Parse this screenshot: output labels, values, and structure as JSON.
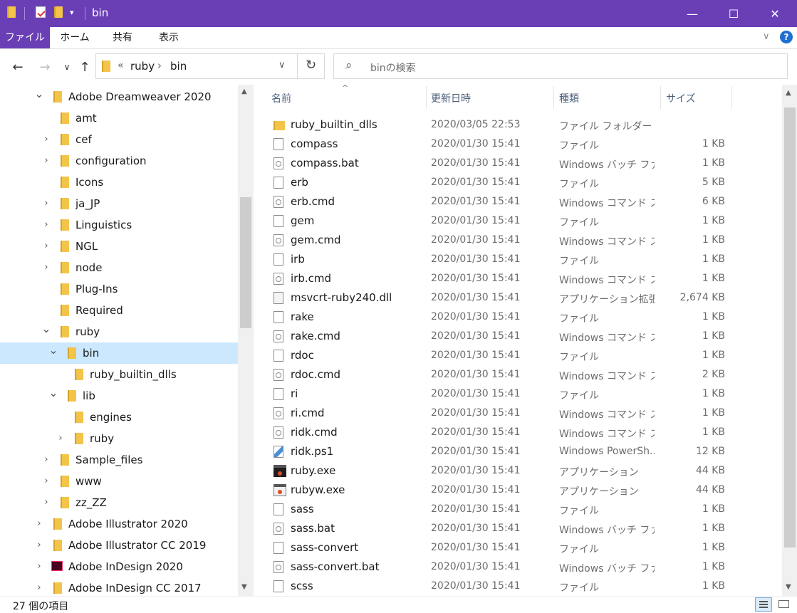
{
  "window": {
    "title": "bin",
    "colors": {
      "titlebar": "#6a3fb6",
      "selected_row": "#cce8ff",
      "folder": "#f2c44a"
    }
  },
  "quick_access": {
    "icons": [
      "folder-icon",
      "properties-icon",
      "new-folder-icon",
      "customize-dropdown-icon"
    ]
  },
  "window_controls": {
    "minimize": "—",
    "maximize": "☐",
    "close": "✕"
  },
  "ribbon": {
    "tabs": [
      {
        "label": "ファイル"
      },
      {
        "label": "ホーム"
      },
      {
        "label": "共有"
      },
      {
        "label": "表示"
      }
    ],
    "expand_glyph": "∨",
    "help_glyph": "?"
  },
  "nav": {
    "back": "←",
    "forward": "→",
    "recent": "∨",
    "up": "↑",
    "address": {
      "overflow": "«",
      "segments": [
        "ruby",
        "bin"
      ],
      "sep": "›",
      "dropdown": "∨",
      "refresh": "↻"
    },
    "search": {
      "placeholder": "binの検索",
      "icon": "⌕"
    }
  },
  "tree": [
    {
      "label": "Adobe Dreamweaver 2020",
      "state": "expanded",
      "level": 0
    },
    {
      "label": "amt",
      "state": "none",
      "level": 1
    },
    {
      "label": "cef",
      "state": "collapsed",
      "level": 1
    },
    {
      "label": "configuration",
      "state": "collapsed",
      "level": 1
    },
    {
      "label": "Icons",
      "state": "none",
      "level": 1
    },
    {
      "label": "ja_JP",
      "state": "collapsed",
      "level": 1
    },
    {
      "label": "Linguistics",
      "state": "collapsed",
      "level": 1
    },
    {
      "label": "NGL",
      "state": "collapsed",
      "level": 1
    },
    {
      "label": "node",
      "state": "collapsed",
      "level": 1
    },
    {
      "label": "Plug-Ins",
      "state": "none",
      "level": 1
    },
    {
      "label": "Required",
      "state": "none",
      "level": 1
    },
    {
      "label": "ruby",
      "state": "expanded",
      "level": 1
    },
    {
      "label": "bin",
      "state": "expanded",
      "level": 2,
      "selected": true
    },
    {
      "label": "ruby_builtin_dlls",
      "state": "none",
      "level": 3
    },
    {
      "label": "lib",
      "state": "expanded",
      "level": 2
    },
    {
      "label": "engines",
      "state": "none",
      "level": 3
    },
    {
      "label": "ruby",
      "state": "collapsed",
      "level": 3
    },
    {
      "label": "Sample_files",
      "state": "collapsed",
      "level": 1
    },
    {
      "label": "www",
      "state": "collapsed",
      "level": 1
    },
    {
      "label": "zz_ZZ",
      "state": "collapsed",
      "level": 1
    },
    {
      "label": "Adobe Illustrator 2020",
      "state": "collapsed",
      "level": 0
    },
    {
      "label": "Adobe Illustrator CC 2019",
      "state": "collapsed",
      "level": 0
    },
    {
      "label": "Adobe InDesign 2020",
      "state": "collapsed",
      "level": 0,
      "icon": "indesign-icon"
    },
    {
      "label": "Adobe InDesign CC 2017",
      "state": "collapsed",
      "level": 0
    }
  ],
  "columns": {
    "name": "名前",
    "date": "更新日時",
    "type": "種類",
    "size": "サイズ",
    "sort_glyph": "^"
  },
  "files": [
    {
      "name": "ruby_builtin_dlls",
      "date": "2020/03/05 22:53",
      "type": "ファイル フォルダー",
      "size": "",
      "icon": "folder"
    },
    {
      "name": "compass",
      "date": "2020/01/30 15:41",
      "type": "ファイル",
      "size": "1 KB",
      "icon": "file"
    },
    {
      "name": "compass.bat",
      "date": "2020/01/30 15:41",
      "type": "Windows バッチ ファ...",
      "size": "1 KB",
      "icon": "gear"
    },
    {
      "name": "erb",
      "date": "2020/01/30 15:41",
      "type": "ファイル",
      "size": "5 KB",
      "icon": "file"
    },
    {
      "name": "erb.cmd",
      "date": "2020/01/30 15:41",
      "type": "Windows コマンド ス...",
      "size": "6 KB",
      "icon": "gear"
    },
    {
      "name": "gem",
      "date": "2020/01/30 15:41",
      "type": "ファイル",
      "size": "1 KB",
      "icon": "file"
    },
    {
      "name": "gem.cmd",
      "date": "2020/01/30 15:41",
      "type": "Windows コマンド ス...",
      "size": "1 KB",
      "icon": "gear"
    },
    {
      "name": "irb",
      "date": "2020/01/30 15:41",
      "type": "ファイル",
      "size": "1 KB",
      "icon": "file"
    },
    {
      "name": "irb.cmd",
      "date": "2020/01/30 15:41",
      "type": "Windows コマンド ス...",
      "size": "1 KB",
      "icon": "gear"
    },
    {
      "name": "msvcrt-ruby240.dll",
      "date": "2020/01/30 15:41",
      "type": "アプリケーション拡張",
      "size": "2,674 KB",
      "icon": "dll"
    },
    {
      "name": "rake",
      "date": "2020/01/30 15:41",
      "type": "ファイル",
      "size": "1 KB",
      "icon": "file"
    },
    {
      "name": "rake.cmd",
      "date": "2020/01/30 15:41",
      "type": "Windows コマンド ス...",
      "size": "1 KB",
      "icon": "gear"
    },
    {
      "name": "rdoc",
      "date": "2020/01/30 15:41",
      "type": "ファイル",
      "size": "1 KB",
      "icon": "file"
    },
    {
      "name": "rdoc.cmd",
      "date": "2020/01/30 15:41",
      "type": "Windows コマンド ス...",
      "size": "2 KB",
      "icon": "gear"
    },
    {
      "name": "ri",
      "date": "2020/01/30 15:41",
      "type": "ファイル",
      "size": "1 KB",
      "icon": "file"
    },
    {
      "name": "ri.cmd",
      "date": "2020/01/30 15:41",
      "type": "Windows コマンド ス...",
      "size": "1 KB",
      "icon": "gear"
    },
    {
      "name": "ridk.cmd",
      "date": "2020/01/30 15:41",
      "type": "Windows コマンド ス...",
      "size": "1 KB",
      "icon": "gear"
    },
    {
      "name": "ridk.ps1",
      "date": "2020/01/30 15:41",
      "type": "Windows PowerSh...",
      "size": "12 KB",
      "icon": "ps"
    },
    {
      "name": "ruby.exe",
      "date": "2020/01/30 15:41",
      "type": "アプリケーション",
      "size": "44 KB",
      "icon": "exe"
    },
    {
      "name": "rubyw.exe",
      "date": "2020/01/30 15:41",
      "type": "アプリケーション",
      "size": "44 KB",
      "icon": "exew"
    },
    {
      "name": "sass",
      "date": "2020/01/30 15:41",
      "type": "ファイル",
      "size": "1 KB",
      "icon": "file"
    },
    {
      "name": "sass.bat",
      "date": "2020/01/30 15:41",
      "type": "Windows バッチ ファ...",
      "size": "1 KB",
      "icon": "gear"
    },
    {
      "name": "sass-convert",
      "date": "2020/01/30 15:41",
      "type": "ファイル",
      "size": "1 KB",
      "icon": "file"
    },
    {
      "name": "sass-convert.bat",
      "date": "2020/01/30 15:41",
      "type": "Windows バッチ ファ...",
      "size": "1 KB",
      "icon": "gear"
    },
    {
      "name": "scss",
      "date": "2020/01/30 15:41",
      "type": "ファイル",
      "size": "1 KB",
      "icon": "file"
    }
  ],
  "status": {
    "count": "27 個の項目"
  }
}
